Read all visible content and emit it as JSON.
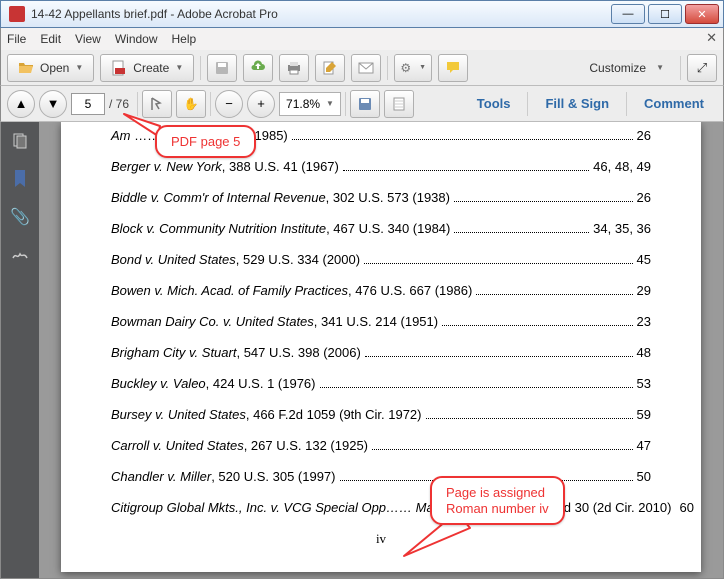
{
  "title": "14-42 Appellants brief.pdf - Adobe Acrobat Pro",
  "menu": [
    "File",
    "Edit",
    "View",
    "Window",
    "Help"
  ],
  "toolbar": {
    "open": "Open",
    "create": "Create",
    "customize": "Customize"
  },
  "nav": {
    "page_current": "5",
    "page_total": "/ 76",
    "zoom": "71.8%"
  },
  "panels": {
    "tools": "Tools",
    "fillsign": "Fill & Sign",
    "comment": "Comment"
  },
  "callouts": {
    "c1": "PDF page 5",
    "c2": "Page is assigned Roman number iv"
  },
  "page_number": "iv",
  "toc": [
    {
      "case_italic": "Am",
      "case_rest": " ……, …… U.S. 115 (1985)",
      "pages": "26"
    },
    {
      "case_italic": "Berger v. New York",
      "case_rest": ", 388 U.S. 41 (1967)",
      "pages": "46, 48, 49"
    },
    {
      "case_italic": "Biddle v. Comm'r of Internal Revenue",
      "case_rest": ", 302 U.S. 573 (1938)",
      "pages": "26"
    },
    {
      "case_italic": "Block v. Community Nutrition Institute",
      "case_rest": ", 467 U.S. 340 (1984)",
      "pages": "34, 35, 36"
    },
    {
      "case_italic": "Bond v. United States",
      "case_rest": ", 529 U.S. 334 (2000)",
      "pages": "45"
    },
    {
      "case_italic": "Bowen v. Mich. Acad. of Family Practices",
      "case_rest": ", 476 U.S. 667 (1986)",
      "pages": "29"
    },
    {
      "case_italic": "Bowman Dairy Co. v. United States",
      "case_rest": ", 341 U.S. 214 (1951)",
      "pages": "23"
    },
    {
      "case_italic": "Brigham City v. Stuart",
      "case_rest": ", 547 U.S. 398 (2006)",
      "pages": "48"
    },
    {
      "case_italic": "Buckley v. Valeo",
      "case_rest": ", 424 U.S. 1 (1976)",
      "pages": "53"
    },
    {
      "case_italic": "Bursey v. United States",
      "case_rest": ", 466 F.2d 1059 (9th Cir. 1972)",
      "pages": "59"
    },
    {
      "case_italic": "Carroll v. United States",
      "case_rest": ", 267 U.S. 132 (1925)",
      "pages": "47"
    },
    {
      "case_italic": "Chandler v. Miller",
      "case_rest": ", 520 U.S. 305 (1997)",
      "pages": "50"
    },
    {
      "case_italic": "Citigroup Global Mkts., Inc. v. VCG Special Opp…… Master Fund Ltd.",
      "case_rest": ", 598 F.3d 30 (2d Cir. 2010)",
      "pages": "60"
    }
  ]
}
